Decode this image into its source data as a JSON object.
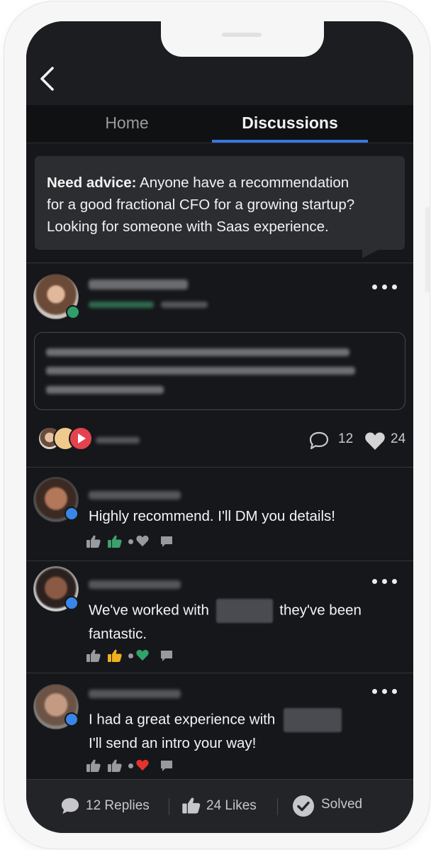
{
  "nav": {
    "back_icon": "chevron-left-icon",
    "tabs": [
      {
        "label": "Home",
        "active": false
      },
      {
        "label": "Discussions",
        "active": true
      }
    ],
    "active_color": "#3678dd"
  },
  "question": {
    "prefix": "Need advice:",
    "lines": [
      " Anyone have a recommendation",
      "for a good fractional CFO for a growing startup?",
      "Looking for someone with Saas experience."
    ]
  },
  "post": {
    "author_status_color": "#2f9e6a",
    "more_icon": "ellipsis-icon",
    "comments_count": "12",
    "likes_count": "24",
    "comment_icon": "speech-bubble-icon",
    "like_icon": "heart-icon"
  },
  "replies": [
    {
      "text_lines": [
        "Highly recommend. I'll DM you details!"
      ],
      "has_more": false,
      "reaction_colors": {
        "thumb": "#3ea06c",
        "heart": "#9a9a9e"
      }
    },
    {
      "text_lines": [
        "We've worked with",
        "they've been",
        "fantastic."
      ],
      "has_more": true,
      "reaction_colors": {
        "thumb": "#f2b01e",
        "heart": "#2fa36b"
      }
    },
    {
      "text_lines": [
        "I had a great experience with",
        "I'll send an intro your way!"
      ],
      "has_more": true,
      "reaction_colors": {
        "thumb": "#9a9a9e",
        "heart": "#e5322f"
      }
    }
  ],
  "footer": {
    "replies_label": "12 Replies",
    "likes_label": "24 Likes",
    "solved_label": "Solved",
    "replies_icon": "speech-bubble-icon",
    "likes_icon": "thumbs-up-icon",
    "solved_icon": "check-circle-icon"
  }
}
